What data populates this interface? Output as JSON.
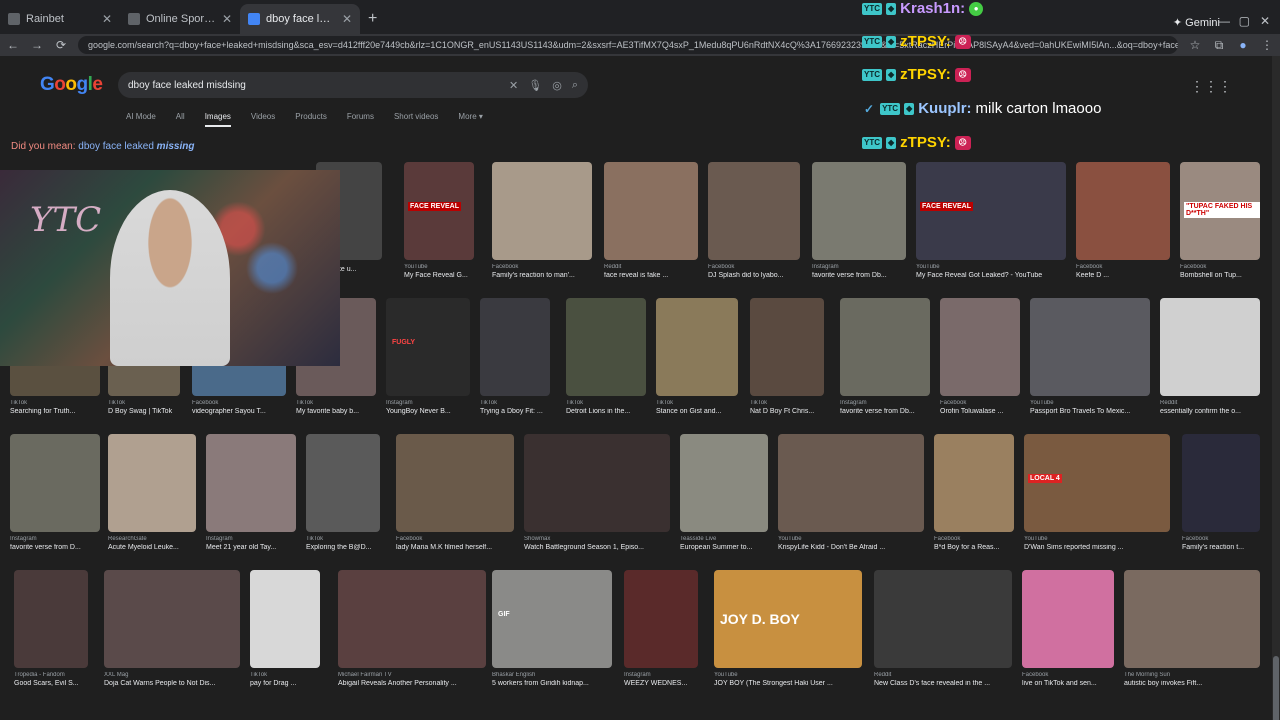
{
  "browser": {
    "tabs": [
      {
        "title": "Rainbet",
        "active": false
      },
      {
        "title": "Online Sportsbook - Rainbet",
        "active": false
      },
      {
        "title": "dboy face leaked misdsing - Go",
        "active": true
      }
    ],
    "gemini_label": "Gemini",
    "url": "google.com/search?q=dboy+face+leaked+misdsing&sca_esv=d412fff20e7449cb&rlz=1C1ONGR_enUS1143US1143&udm=2&sxsrf=AE3TifMX7Q4sxP_1Medu8qPU6nRdtNX4cQ%3A1766923239308&ei=5xtRaczHErPiwPAP8lSAyA4&ved=0ahUKEwiMI5lAn...&oq=dboy+face+leaked+mis..."
  },
  "google": {
    "logo": "Google",
    "query": "dboy face leaked misdsing",
    "filters": [
      "AI Mode",
      "All",
      "Images",
      "Videos",
      "Products",
      "Forums",
      "Short videos",
      "More"
    ],
    "active_filter": "Images",
    "did_you_mean_label": "Did you mean:",
    "did_you_mean_prefix": "dboy face leaked",
    "did_you_mean_fix": "missing"
  },
  "results": [
    {
      "src": "",
      "cap": "...e make u...",
      "color": "#444"
    },
    {
      "src": "YouTube",
      "cap": "My Face Reveal G...",
      "color": "#5a3a3a"
    },
    {
      "src": "Facebook",
      "cap": "Family's reaction to man'...",
      "color": "#a89a8a"
    },
    {
      "src": "Reddit",
      "cap": "face reveal is fake ...",
      "color": "#8a7060"
    },
    {
      "src": "Facebook",
      "cap": "DJ Splash did to lyabo...",
      "color": "#6a5a50"
    },
    {
      "src": "Instagram",
      "cap": "favorite verse from Db...",
      "color": "#7a7a70"
    },
    {
      "src": "YouTube",
      "cap": "My Face Reveal Got Leaked? - YouTube",
      "color": "#3a3a4a"
    },
    {
      "src": "Facebook",
      "cap": "Keefe D ...",
      "color": "#8a5040"
    },
    {
      "src": "Facebook",
      "cap": "Bombshell on Tup...",
      "color": "#9a8a80"
    },
    {
      "src": "TikTok",
      "cap": "Searching for Truth...",
      "color": "#5a5040"
    },
    {
      "src": "TikTok",
      "cap": "D Boy Swag | TikTok",
      "color": "#6a6050"
    },
    {
      "src": "Facebook",
      "cap": "videographer Sayou T...",
      "color": "#4a6a8a"
    },
    {
      "src": "TikTok",
      "cap": "My favorite baby b...",
      "color": "#6a5a5a"
    },
    {
      "src": "Instagram",
      "cap": "YoungBoy Never B...",
      "color": "#2a2a2a"
    },
    {
      "src": "TikTok",
      "cap": "Trying a Dboy Fit: ...",
      "color": "#3a3a40"
    },
    {
      "src": "TikTok",
      "cap": "Detroit Lions in the...",
      "color": "#4a5040"
    },
    {
      "src": "TikTok",
      "cap": "Stance on Gist and...",
      "color": "#8a7a5a"
    },
    {
      "src": "TikTok",
      "cap": "Nat D Boy Ft Chris...",
      "color": "#5a4a40"
    },
    {
      "src": "Instagram",
      "cap": "favorite verse from Db...",
      "color": "#6a6a60"
    },
    {
      "src": "Facebook",
      "cap": "Orofin Toluwalase ...",
      "color": "#7a6a6a"
    },
    {
      "src": "YouTube",
      "cap": "Passport Bro Travels To Mexic...",
      "color": "#5a5a60"
    },
    {
      "src": "Reddit",
      "cap": "essentially confirm the o...",
      "color": "#d0d0d0"
    },
    {
      "src": "Instagram",
      "cap": "favorite verse from D...",
      "color": "#6a6a60"
    },
    {
      "src": "ResearchGate",
      "cap": "Acute Myeloid Leuke...",
      "color": "#b0a090"
    },
    {
      "src": "Instagram",
      "cap": "Meet 21 year old Tay...",
      "color": "#8a7a7a"
    },
    {
      "src": "TikTok",
      "cap": "Exploring the B@D...",
      "color": "#5a5a5a"
    },
    {
      "src": "Facebook",
      "cap": "lady Maria M.K filmed herself...",
      "color": "#6a5a4a"
    },
    {
      "src": "Showmax",
      "cap": "Watch Battleground Season 1, Episo...",
      "color": "#3a3030"
    },
    {
      "src": "Teasside Live",
      "cap": "European Summer to...",
      "color": "#8a8a80"
    },
    {
      "src": "YouTube",
      "cap": "KrispyLife Kidd - Don't Be Afraid ...",
      "color": "#6a5a50"
    },
    {
      "src": "Facebook",
      "cap": "B*d Boy for a Reas...",
      "color": "#9a8060"
    },
    {
      "src": "YouTube",
      "cap": "D'Wan Sims reported missing ...",
      "color": "#7a5a40"
    },
    {
      "src": "Facebook",
      "cap": "Family's reaction t...",
      "color": "#2a2a3a"
    },
    {
      "src": "Tropedia - Fandom",
      "cap": "Good Scars, Evil S...",
      "color": "#4a3a3a"
    },
    {
      "src": "XXL Mag",
      "cap": "Doja Cat Warns People to Not Dis...",
      "color": "#5a4a4a"
    },
    {
      "src": "TikTok",
      "cap": "pay for Drag ...",
      "color": "#d8d8d8"
    },
    {
      "src": "Michael Fairman TV",
      "cap": "Abigail Reveals Another Personality ...",
      "color": "#5a4040"
    },
    {
      "src": "Bhaskar English",
      "cap": "5 workers from Giridih kidnap...",
      "color": "#8a8a88"
    },
    {
      "src": "Instagram",
      "cap": "WEEZY WEDNES...",
      "color": "#5a2a2a"
    },
    {
      "src": "YouTube",
      "cap": "JOY BOY (The Strongest Haki User ...",
      "color": "#c89040"
    },
    {
      "src": "Reddit",
      "cap": "New Class D's face revealed in the ...",
      "color": "#3a3a3a"
    },
    {
      "src": "Facebook",
      "cap": "live on TikTok and sen...",
      "color": "#d070a0"
    },
    {
      "src": "The Morning Sun",
      "cap": "autistic boy invokes Fift...",
      "color": "#7a6a60"
    }
  ],
  "thumb_text": {
    "face_reveal_1": "FACE REVEAL",
    "face_reveal_2": "FACE REVEAL",
    "tupac": "\"TUPAC FAKED HIS D**TH\"",
    "fugly": "FUGLY",
    "local": "LOCAL 4",
    "joy_boy": "JOY D. BOY",
    "gif": "GIF"
  },
  "webcam": {
    "overlay_text": "YTC"
  },
  "chat": [
    {
      "badges": [
        "YTC",
        "gem"
      ],
      "user": "Krash1n:",
      "emote": "green",
      "msg": ""
    },
    {
      "badges": [
        "YTC",
        "gem"
      ],
      "user": "zTPSY:",
      "emote": "face",
      "msg": ""
    },
    {
      "badges": [
        "YTC",
        "gem"
      ],
      "user": "zTPSY:",
      "emote": "face",
      "msg": ""
    },
    {
      "badges": [
        "tick",
        "YTC",
        "gem"
      ],
      "user": "Kuuplr:",
      "emote": "",
      "msg": "milk carton lmaooo"
    },
    {
      "badges": [
        "YTC",
        "gem"
      ],
      "user": "zTPSY:",
      "emote": "face",
      "msg": ""
    }
  ]
}
